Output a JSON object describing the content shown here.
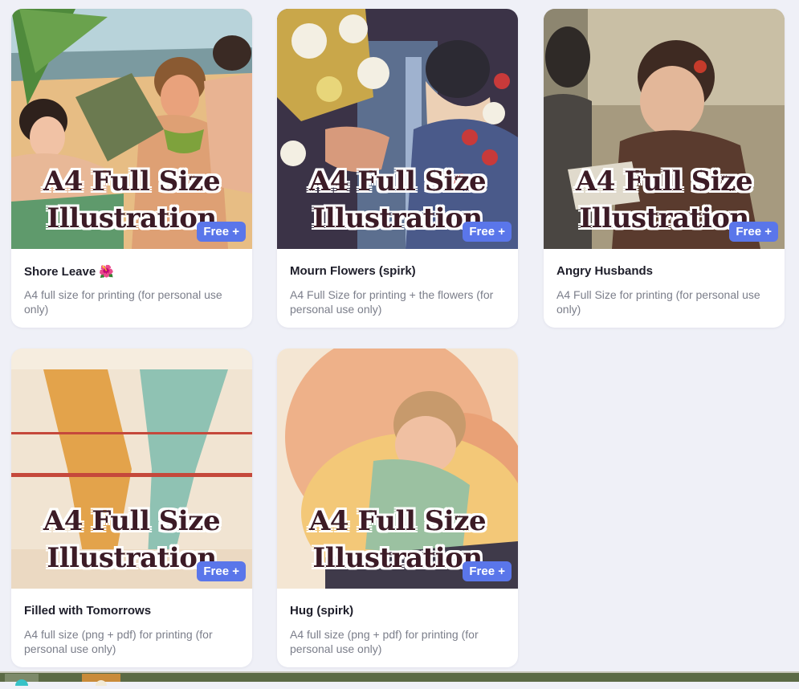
{
  "cards": [
    {
      "title": "Shore Leave",
      "emoji": "🌺",
      "description": "A4 full size for printing (for personal use only)",
      "overlay_line1": "A4 Full Size",
      "overlay_line2": "Illustration",
      "badge": "Free +"
    },
    {
      "title": "Mourn Flowers (spirk)",
      "description": "A4 Full Size for printing + the flowers (for personal use only)",
      "overlay_line1": "A4 Full Size",
      "overlay_line2": "Illustration",
      "badge": "Free +"
    },
    {
      "title": "Angry Husbands",
      "description": "A4 Full Size for printing (for personal use only)",
      "overlay_line1": "A4 Full Size",
      "overlay_line2": "Illustration",
      "badge": "Free +"
    },
    {
      "title": "Filled with Tomorrows",
      "description": "A4 full size (png + pdf) for printing (for personal use only)",
      "overlay_line1": "A4 Full Size",
      "overlay_line2": "Illustration",
      "badge": "Free +"
    },
    {
      "title": "Hug (spirk)",
      "description": "A4 full size (png + pdf) for printing (for personal use only)",
      "overlay_line1": "A4 Full Size",
      "overlay_line2": "Illustration",
      "badge": "Free +"
    }
  ],
  "colors": {
    "page_bg": "#eff0f7",
    "badge_bg": "#5a76ea",
    "overlay_text": "#3c1b26",
    "title_text": "#1e1e2a",
    "desc_text": "#7b7e8a",
    "taskbar": "#5b6a45"
  },
  "icons": [
    "taskbar-app-icon",
    "taskbar-app-icon"
  ]
}
